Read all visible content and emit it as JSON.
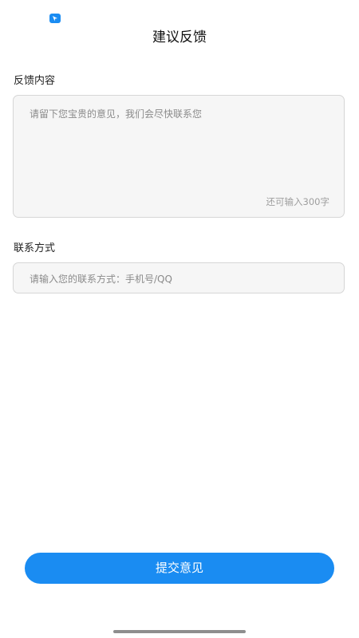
{
  "status_bar": {
    "app_icon": "app-logo-icon",
    "accent_color": "#1a8cf2"
  },
  "header": {
    "title": "建议反馈"
  },
  "feedback": {
    "label": "反馈内容",
    "placeholder": "请留下您宝贵的意见，我们会尽快联系您",
    "counter": "还可输入300字"
  },
  "contact": {
    "label": "联系方式",
    "placeholder": "请输入您的联系方式：手机号/QQ"
  },
  "actions": {
    "submit_label": "提交意见"
  }
}
